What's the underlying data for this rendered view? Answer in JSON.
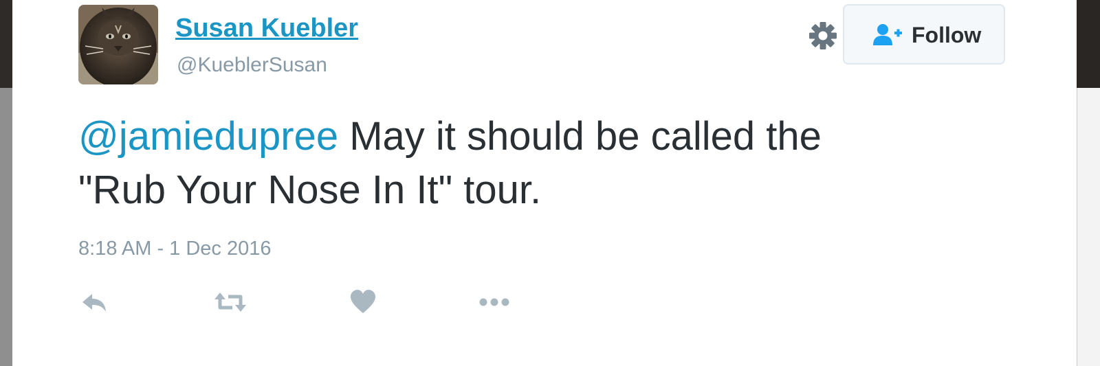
{
  "tweet": {
    "display_name": "Susan Kuebler",
    "handle": "@KueblerSusan",
    "mention": "@jamiedupree",
    "text_line1_rest": " May it should be called the",
    "text_line2": "\"Rub Your Nose In It\" tour.",
    "timestamp": "8:18 AM - 1 Dec 2016"
  },
  "header": {
    "follow_label": "Follow",
    "settings_icon": "gear-icon",
    "follow_icon": "person-plus-icon"
  },
  "actions": {
    "icons": [
      "reply-icon",
      "retweet-icon",
      "like-icon",
      "more-icon"
    ]
  },
  "colors": {
    "link_blue": "#1b95c4",
    "text": "#292f33",
    "muted": "#8899a6",
    "action_icon": "#aab8c2"
  }
}
